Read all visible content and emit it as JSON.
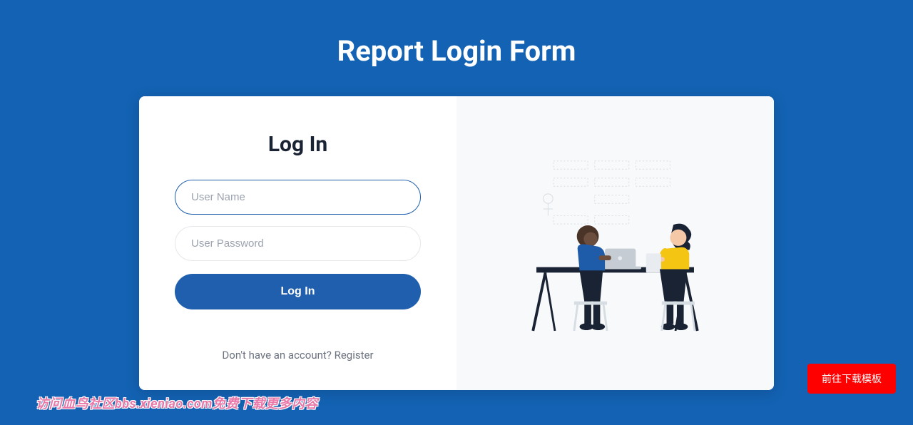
{
  "page": {
    "title": "Report Login Form"
  },
  "form": {
    "title": "Log In",
    "username_placeholder": "User Name",
    "password_placeholder": "User Password",
    "submit_label": "Log In",
    "register_prompt": "Don't have an account? ",
    "register_link": "Register"
  },
  "buttons": {
    "download_template": "前往下载模板"
  },
  "watermark": {
    "text": "访问血鸟社区bbs.xieniao.com免费下载更多内容"
  },
  "colors": {
    "primary_blue": "#1362b3",
    "button_blue": "#1f5fad",
    "accent_red": "#ff0000"
  }
}
